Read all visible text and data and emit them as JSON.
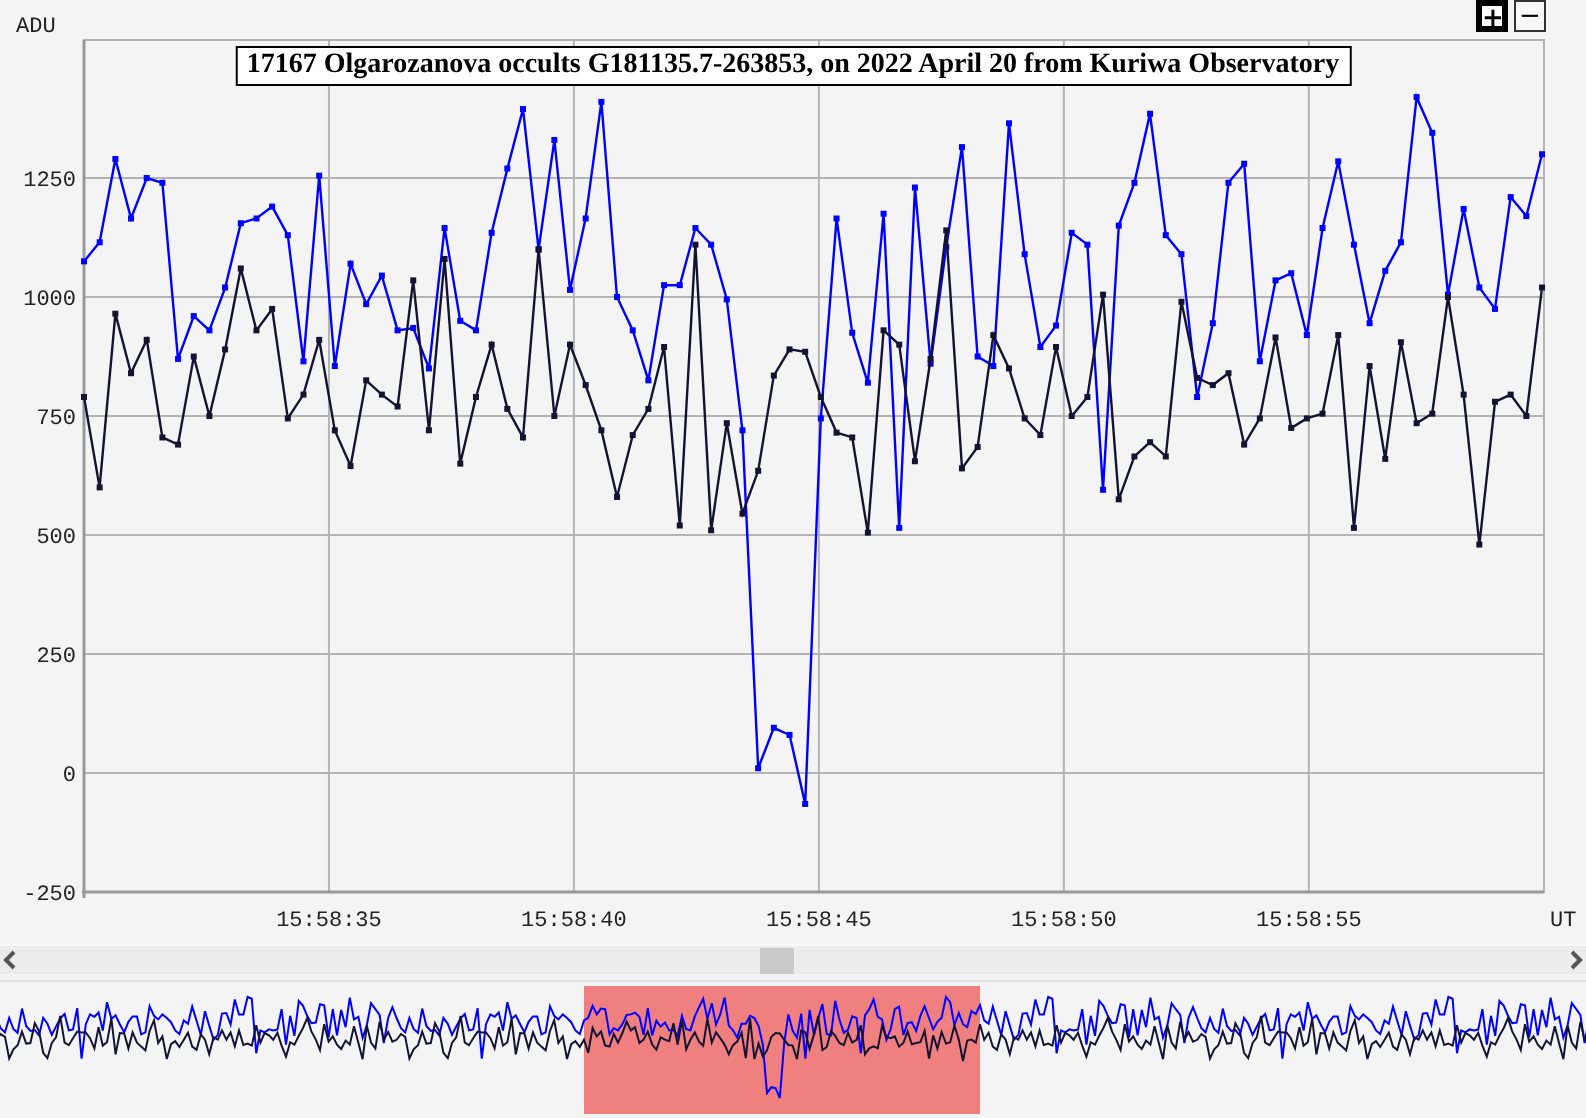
{
  "zoom_buttons": [
    {
      "label": "+",
      "selected": true
    },
    {
      "label": "−",
      "selected": false
    }
  ],
  "chart": {
    "chart_data": {
      "type": "line",
      "title": "17167 Olgarozanova occults G181135.7-263853, on 2022 April 20 from Kuriwa Observatory",
      "xlabel": "UT",
      "ylabel": "ADU",
      "grid": true,
      "xlim": [
        57510,
        57539.8
      ],
      "ylim": [
        -250,
        1540
      ],
      "xticks": [
        {
          "value": 57515,
          "label": "15:58:35"
        },
        {
          "value": 57520,
          "label": "15:58:40"
        },
        {
          "value": 57525,
          "label": "15:58:45"
        },
        {
          "value": 57530,
          "label": "15:58:50"
        },
        {
          "value": 57535,
          "label": "15:58:55"
        }
      ],
      "yticks": [
        -250,
        0,
        250,
        500,
        750,
        1000,
        1250
      ],
      "x": [
        57510.0,
        57510.32,
        57510.64,
        57510.96,
        57511.28,
        57511.6,
        57511.92,
        57512.24,
        57512.56,
        57512.88,
        57513.2,
        57513.52,
        57513.84,
        57514.16,
        57514.48,
        57514.8,
        57515.12,
        57515.44,
        57515.76,
        57516.08,
        57516.4,
        57516.72,
        57517.04,
        57517.36,
        57517.68,
        57518.0,
        57518.32,
        57518.64,
        57518.96,
        57519.28,
        57519.6,
        57519.92,
        57520.24,
        57520.56,
        57520.88,
        57521.2,
        57521.52,
        57521.84,
        57522.16,
        57522.48,
        57522.8,
        57523.12,
        57523.44,
        57523.76,
        57524.08,
        57524.4,
        57524.72,
        57525.04,
        57525.36,
        57525.68,
        57526.0,
        57526.32,
        57526.64,
        57526.96,
        57527.28,
        57527.6,
        57527.92,
        57528.24,
        57528.56,
        57528.88,
        57529.2,
        57529.52,
        57529.84,
        57530.16,
        57530.48,
        57530.8,
        57531.12,
        57531.44,
        57531.76,
        57532.08,
        57532.4,
        57532.72,
        57533.04,
        57533.36,
        57533.68,
        57534.0,
        57534.32,
        57534.64,
        57534.96,
        57535.28,
        57535.6,
        57535.92,
        57536.24,
        57536.56,
        57536.88,
        57537.2,
        57537.52,
        57537.84,
        57538.16,
        57538.48,
        57538.8,
        57539.12,
        57539.44,
        57539.76
      ],
      "series": [
        {
          "color": "#0000ff",
          "marker": "square",
          "values": [
            1075,
            1115,
            1290,
            1165,
            1250,
            1240,
            870,
            960,
            930,
            1020,
            1155,
            1165,
            1190,
            1130,
            865,
            1255,
            855,
            1070,
            985,
            1045,
            930,
            935,
            850,
            1145,
            950,
            930,
            1135,
            1270,
            1395,
            1100,
            1330,
            1015,
            1165,
            1410,
            1000,
            930,
            825,
            1025,
            1025,
            1145,
            1110,
            995,
            720,
            10,
            95,
            80,
            -65,
            745,
            1165,
            925,
            820,
            1175,
            515,
            1230,
            860,
            1105,
            1315,
            875,
            855,
            1365,
            1090,
            895,
            940,
            1135,
            1110,
            595,
            1150,
            1240,
            1385,
            1130,
            1090,
            790,
            945,
            1240,
            1280,
            865,
            1035,
            1050,
            920,
            1145,
            1285,
            1110,
            945,
            1055,
            1115,
            1420,
            1345,
            1005,
            1185,
            1020,
            975,
            1210,
            1170,
            1300
          ]
        },
        {
          "color": "#141432",
          "marker": "square",
          "values": [
            790,
            600,
            965,
            840,
            910,
            705,
            690,
            875,
            750,
            890,
            1060,
            930,
            975,
            745,
            795,
            910,
            720,
            645,
            825,
            795,
            770,
            1035,
            720,
            1080,
            650,
            790,
            900,
            765,
            705,
            1100,
            750,
            900,
            815,
            720,
            580,
            710,
            765,
            895,
            520,
            1110,
            510,
            735,
            545,
            635,
            835,
            890,
            885,
            790,
            715,
            705,
            505,
            930,
            900,
            655,
            870,
            1140,
            640,
            685,
            920,
            850,
            745,
            710,
            895,
            750,
            790,
            1005,
            575,
            665,
            695,
            665,
            990,
            830,
            815,
            840,
            690,
            745,
            915,
            725,
            745,
            755,
            920,
            515,
            855,
            660,
            905,
            735,
            755,
            1000,
            795,
            480,
            780,
            795,
            750,
            1020
          ]
        }
      ]
    }
  }
}
